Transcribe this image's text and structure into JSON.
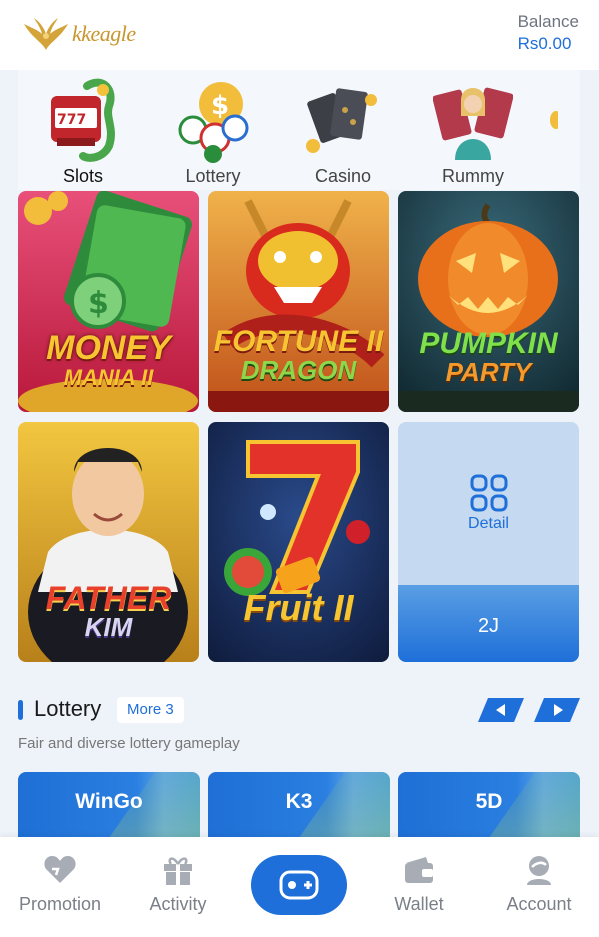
{
  "brand": {
    "logo_text": "kkeagle"
  },
  "balance": {
    "label": "Balance",
    "value": "Rs0.00"
  },
  "categories": [
    {
      "label": "Slots",
      "icon": "slot-machine-icon",
      "active": true
    },
    {
      "label": "Lottery",
      "icon": "lottery-balls-icon",
      "active": false
    },
    {
      "label": "Casino",
      "icon": "cards-icon",
      "active": false
    },
    {
      "label": "Rummy",
      "icon": "rummy-dealer-icon",
      "active": false
    }
  ],
  "games": [
    {
      "title_a": "MONEY",
      "title_b": "MANIA II"
    },
    {
      "title_a": "FORTUNE II",
      "title_b": "DRAGON"
    },
    {
      "title_a": "PUMPKIN",
      "title_b": "PARTY"
    },
    {
      "title_a": "FATHER",
      "title_b": "KIM"
    },
    {
      "title_a": "Fruit II",
      "title_b": ""
    }
  ],
  "detail_tile": {
    "label": "Detail",
    "count": "2J"
  },
  "lottery_section": {
    "title": "Lottery",
    "more": "More 3",
    "subtitle": "Fair and diverse lottery gameplay",
    "items": [
      "WinGo",
      "K3",
      "5D"
    ]
  },
  "tabbar": {
    "promotion": "Promotion",
    "activity": "Activity",
    "wallet": "Wallet",
    "account": "Account"
  },
  "colors": {
    "accent": "#1e6fd9",
    "background": "#eef3fa"
  }
}
